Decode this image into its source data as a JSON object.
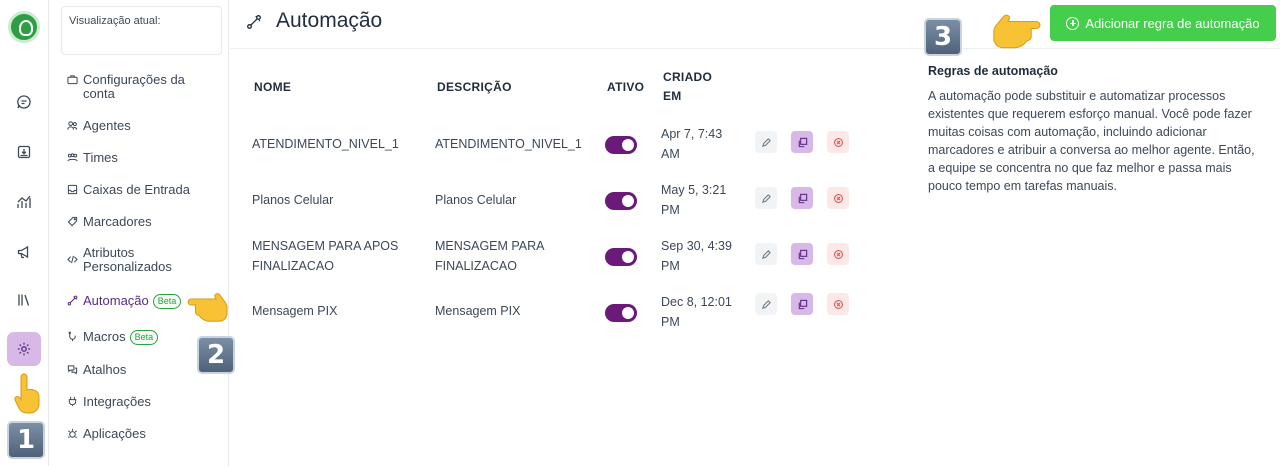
{
  "rail": {
    "icons": [
      "conversations-icon",
      "inbox-icon",
      "reports-icon",
      "campaigns-icon",
      "library-icon",
      "settings-icon"
    ]
  },
  "sidebar": {
    "current_view_label": "Visualização atual:",
    "items": [
      {
        "label": "Configurações da conta",
        "icon": "briefcase-icon"
      },
      {
        "label": "Agentes",
        "icon": "people-icon"
      },
      {
        "label": "Times",
        "icon": "team-icon"
      },
      {
        "label": "Caixas de Entrada",
        "icon": "inbox-icon"
      },
      {
        "label": "Marcadores",
        "icon": "tag-icon"
      },
      {
        "label": "Atributos Personalizados",
        "icon": "code-icon"
      },
      {
        "label": "Automação",
        "icon": "automation-icon",
        "badge": "Beta",
        "active": true
      },
      {
        "label": "Macros",
        "icon": "macro-icon",
        "badge": "Beta"
      },
      {
        "label": "Atalhos",
        "icon": "chat-icon"
      },
      {
        "label": "Integrações",
        "icon": "plug-icon"
      },
      {
        "label": "Aplicações",
        "icon": "apps-icon"
      }
    ]
  },
  "header": {
    "title": "Automação",
    "add_button": "Adicionar regra de automação"
  },
  "table": {
    "columns": [
      "NOME",
      "DESCRIÇÃO",
      "ATIVO",
      "CRIADO EM"
    ],
    "rows": [
      {
        "name": "ATENDIMENTO_NIVEL_1",
        "description": "ATENDIMENTO_NIVEL_1",
        "active": true,
        "created": "Apr 7, 7:43 AM"
      },
      {
        "name": "Planos Celular",
        "description": "Planos Celular",
        "active": true,
        "created": "May 5, 3:21 PM"
      },
      {
        "name": "MENSAGEM PARA APOS FINALIZACAO",
        "description": "MENSAGEM PARA FINALIZACAO",
        "active": true,
        "created": "Sep 30, 4:39 PM"
      },
      {
        "name": "Mensagem PIX",
        "description": "Mensagem PIX",
        "active": true,
        "created": "Dec 8, 12:01 PM"
      }
    ]
  },
  "info": {
    "title": "Regras de automação",
    "body": "A automação pode substituir e automatizar processos existentes que requerem esforço manual. Você pode fazer muitas coisas com automação, incluindo adicionar marcadores e atribuir a conversa ao melhor agente. Então, a equipe se concentra no que faz melhor e passa mais pouco tempo em tarefas manuais."
  },
  "markers": {
    "step1": "1",
    "step2": "2",
    "step3": "3"
  },
  "colors": {
    "accent": "#6a1b7a",
    "add_button": "#44ce4b",
    "active_nav": "#5b2c83"
  }
}
